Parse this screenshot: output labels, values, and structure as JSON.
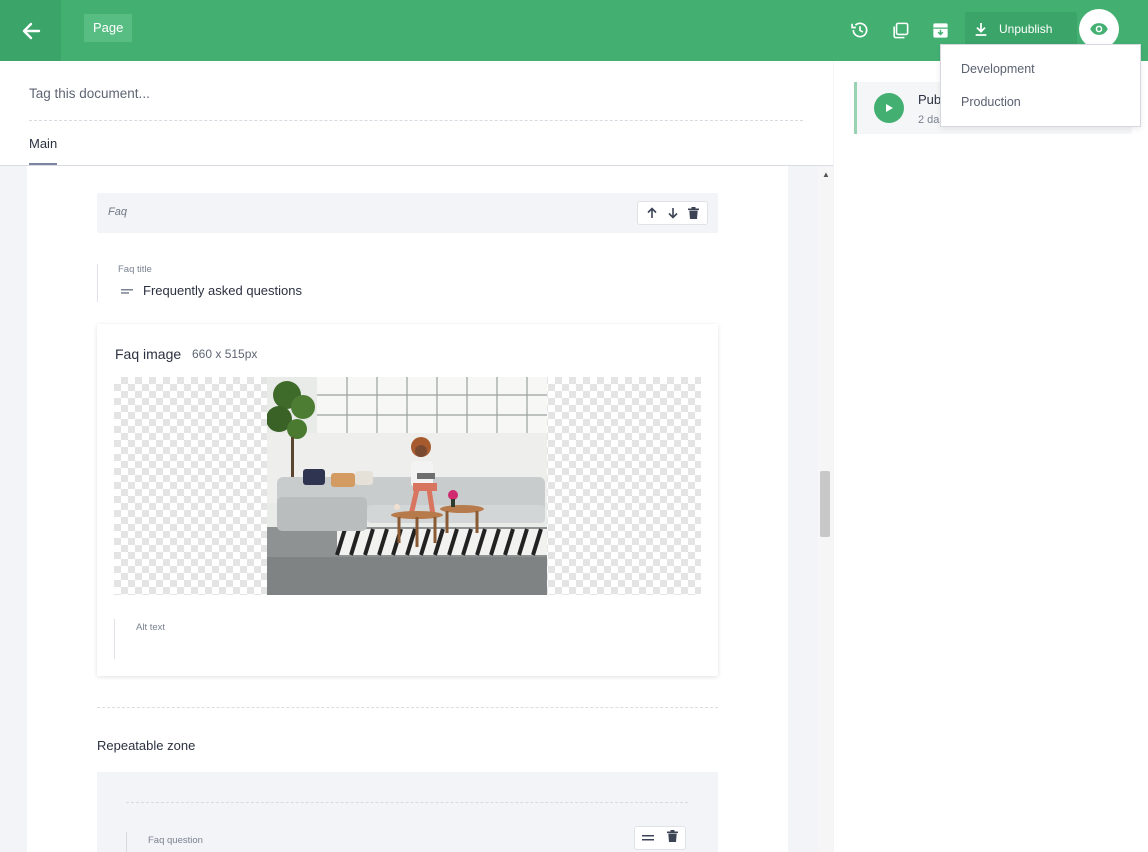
{
  "topbar": {
    "page_chip": "Page",
    "unpublish_label": "Unpublish"
  },
  "document": {
    "tag_placeholder": "Tag this document...",
    "tabs": [
      {
        "label": "Main"
      }
    ]
  },
  "faq_slice": {
    "title": "Faq",
    "faq_title_label": "Faq title",
    "faq_title_value": "Frequently asked questions",
    "image": {
      "label": "Faq image",
      "dimensions": "660 x 515px",
      "alt_text_label": "Alt text"
    }
  },
  "repeatable_zone": {
    "label": "Repeatable zone",
    "faq_question_label": "Faq question"
  },
  "status_panel": {
    "title": "Pub",
    "subtitle": "2 da"
  },
  "preview_menu": {
    "items": [
      "Development",
      "Production"
    ]
  },
  "colors": {
    "accent": "#43b072",
    "accent_dark": "#3ba468"
  }
}
